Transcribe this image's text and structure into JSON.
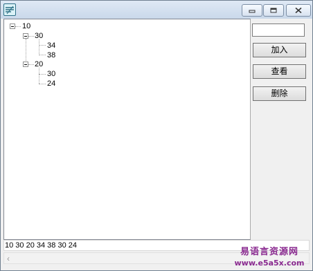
{
  "window": {
    "title": "",
    "controls": {
      "minimize_icon": "minimize-icon",
      "maximize_icon": "maximize-icon",
      "close_icon": "close-icon"
    }
  },
  "tree": {
    "root": {
      "label": "10",
      "children": [
        {
          "label": "30",
          "children": [
            {
              "label": "34"
            },
            {
              "label": "38"
            }
          ]
        },
        {
          "label": "20",
          "children": [
            {
              "label": "30"
            },
            {
              "label": "24"
            }
          ]
        }
      ]
    }
  },
  "side": {
    "input_value": "",
    "add_button": "加入",
    "view_button": "查看",
    "delete_button": "删除"
  },
  "status_text": "10 30 20 34 38 30 24",
  "watermark": {
    "line1": "易语言资源网",
    "line2": "www.e5a5x.com"
  }
}
